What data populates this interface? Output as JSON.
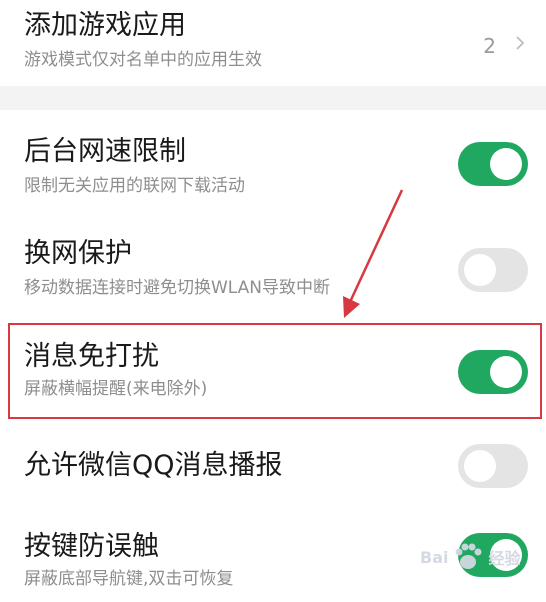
{
  "settings": {
    "game_apps": {
      "title": "添加游戏应用",
      "subtitle": "游戏模式仅对名单中的应用生效",
      "count": "2"
    },
    "items": [
      {
        "title": "后台网速限制",
        "subtitle": "限制无关应用的联网下载活动",
        "enabled": true
      },
      {
        "title": "换网保护",
        "subtitle": "移动数据连接时避免切换WLAN导致中断",
        "enabled": false
      },
      {
        "title": "消息免打扰",
        "subtitle": "屏蔽横幅提醒(来电除外)",
        "enabled": true
      },
      {
        "title": "允许微信QQ消息播报",
        "subtitle": "",
        "enabled": false
      },
      {
        "title": "按键防误触",
        "subtitle": "屏蔽底部导航键,双击可恢复",
        "enabled": true
      }
    ]
  },
  "watermark": {
    "text": "Bai",
    "text2": "经验"
  },
  "colors": {
    "toggle_on": "#20a860",
    "toggle_off": "#e4e4e4",
    "annotation_red": "#d8383f"
  },
  "icons": {
    "chevron": "chevron-right-icon",
    "arrow": "annotation-arrow-icon",
    "watermark": "paw-icon"
  }
}
